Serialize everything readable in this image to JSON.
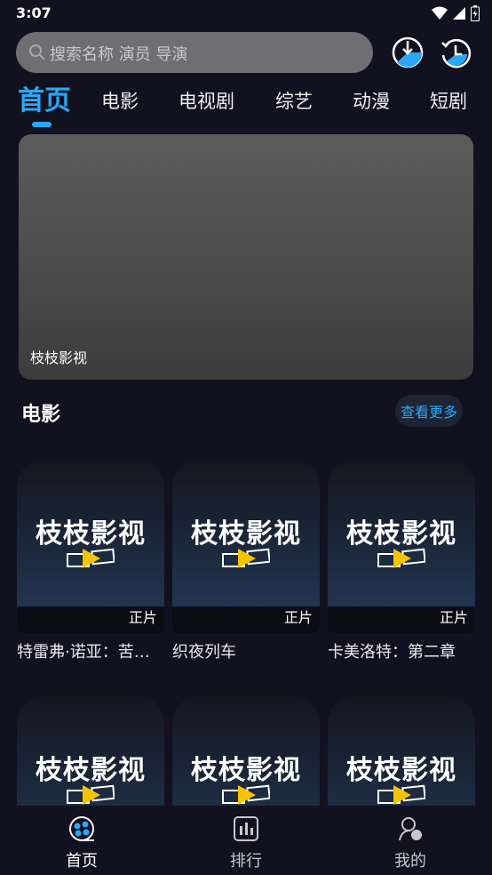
{
  "status": {
    "time": "3:07"
  },
  "search": {
    "placeholder": "搜索名称 演员 导演"
  },
  "icons": {
    "search": "search-icon",
    "downloads": "download-icon",
    "history": "history-icon",
    "home": "home-icon",
    "ranking": "ranking-icon",
    "profile": "profile-icon"
  },
  "tabs": [
    {
      "label": "首页",
      "active": true
    },
    {
      "label": "电影"
    },
    {
      "label": "电视剧"
    },
    {
      "label": "综艺"
    },
    {
      "label": "动漫"
    },
    {
      "label": "短剧"
    }
  ],
  "banner": {
    "caption": "枝枝影视"
  },
  "section": {
    "title": "电影",
    "more": "查看更多"
  },
  "poster_brand": "枝枝影视",
  "movies": [
    {
      "title": "特雷弗·诺亚：苦…",
      "badge": "正片"
    },
    {
      "title": "织夜列车",
      "badge": "正片"
    },
    {
      "title": "卡美洛特：第二章",
      "badge": "正片"
    },
    {
      "title": "",
      "badge": ""
    },
    {
      "title": "",
      "badge": ""
    },
    {
      "title": "",
      "badge": ""
    }
  ],
  "nav": [
    {
      "label": "首页",
      "active": true
    },
    {
      "label": "排行"
    },
    {
      "label": "我的"
    }
  ],
  "colors": {
    "accent": "#2aa8f5",
    "background": "#111120",
    "search_bg": "#6e6e73"
  }
}
